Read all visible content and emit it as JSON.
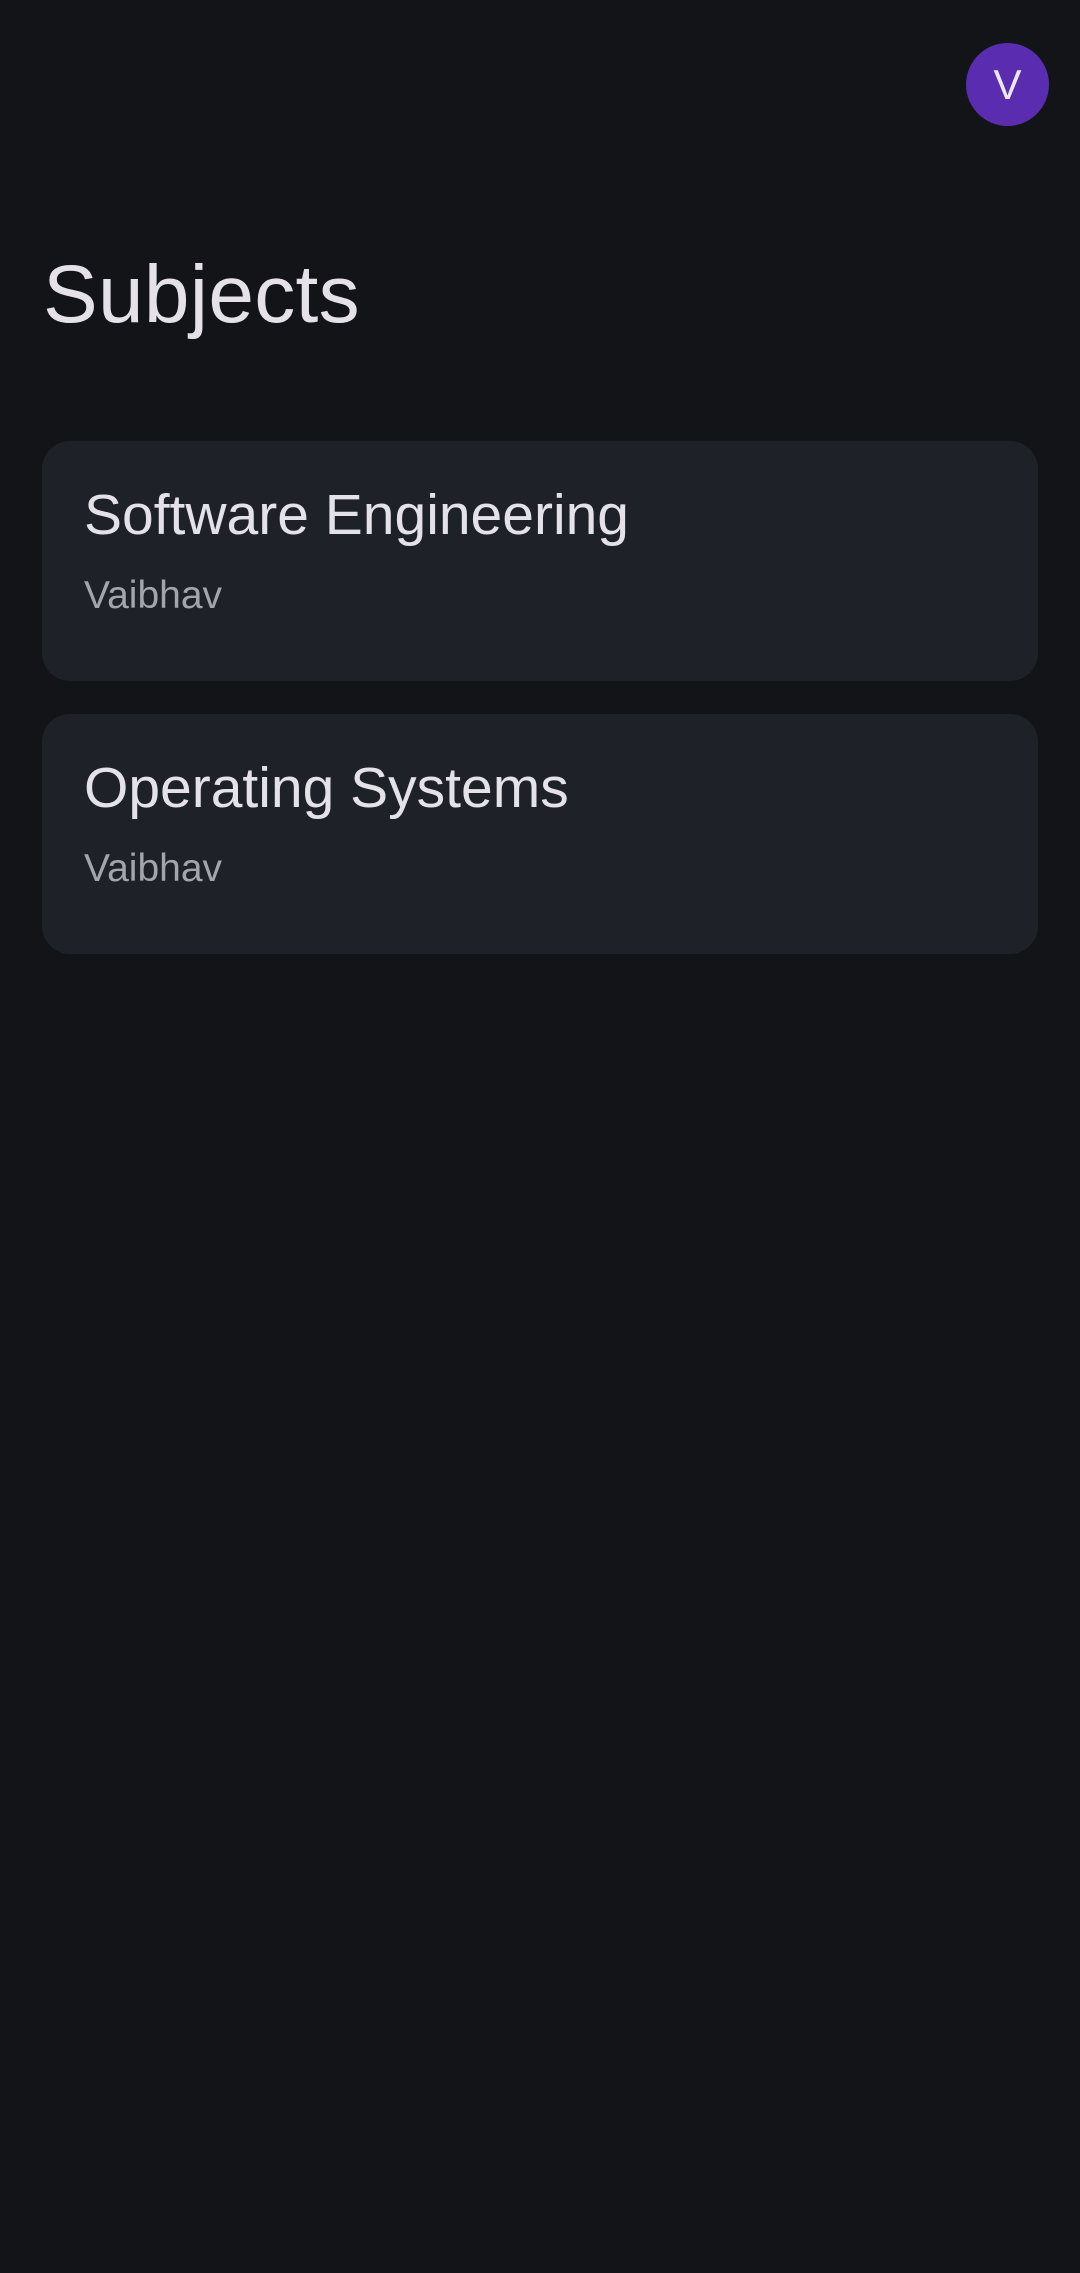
{
  "header": {
    "avatar_initial": "V",
    "avatar_color": "#5a2db0"
  },
  "page": {
    "title": "Subjects"
  },
  "subjects": [
    {
      "name": "Software Engineering",
      "teacher": "Vaibhav"
    },
    {
      "name": "Operating Systems",
      "teacher": "Vaibhav"
    }
  ],
  "colors": {
    "background": "#131417",
    "card": "#1f2129",
    "primary_text": "#e4e2e8",
    "secondary_text": "#a3a5ad"
  }
}
